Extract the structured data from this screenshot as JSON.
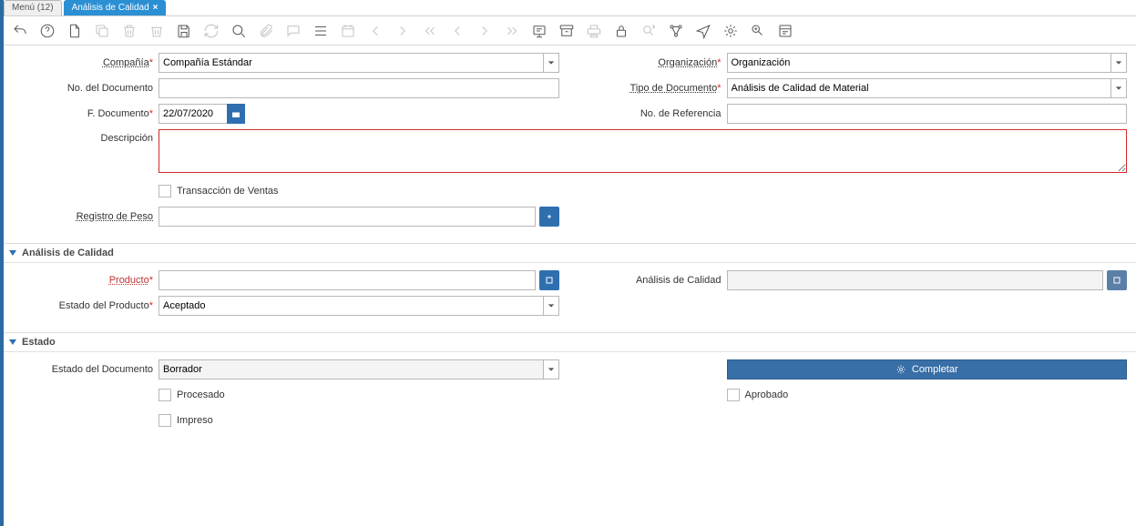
{
  "tabs": {
    "menu": "Menú (12)",
    "active": "Análisis de Calidad"
  },
  "form": {
    "companyLabel": "Compañía",
    "companyValue": "Compañía Estándar",
    "orgLabel": "Organización",
    "orgValue": "Organización",
    "docNoLabel": "No. del Documento",
    "docNoValue": "",
    "docTypeLabel": "Tipo de Documento",
    "docTypeValue": "Análisis de Calidad de Material",
    "docDateLabel": "F. Documento",
    "docDateValue": "22/07/2020",
    "refNoLabel": "No. de Referencia",
    "refNoValue": "",
    "descLabel": "Descripción",
    "descValue": "",
    "salesTxLabel": "Transacción de Ventas",
    "weightLabel": "Registro de Peso",
    "weightValue": ""
  },
  "sectionAnalisis": {
    "title": "Análisis de Calidad",
    "productLabel": "Producto",
    "productValue": "",
    "analysisLabel": "Análisis de Calidad",
    "analysisValue": "",
    "prodStatusLabel": "Estado del Producto",
    "prodStatusValue": "Aceptado"
  },
  "sectionEstado": {
    "title": "Estado",
    "docStatusLabel": "Estado del Documento",
    "docStatusValue": "Borrador",
    "completeLabel": "Completar",
    "processedLabel": "Procesado",
    "approvedLabel": "Aprobado",
    "printedLabel": "Impreso"
  }
}
